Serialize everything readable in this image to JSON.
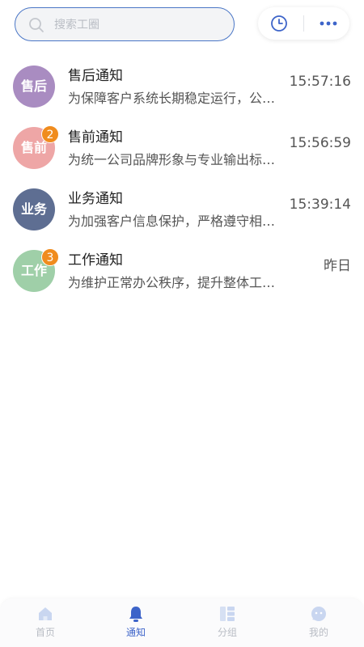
{
  "search": {
    "placeholder": "搜索工圈",
    "icon": "search-icon"
  },
  "header_actions": [
    {
      "icon": "clock-icon"
    },
    {
      "icon": "more-icon"
    }
  ],
  "notifications": [
    {
      "avatar_text": "售后",
      "avatar_color": "#a98cc1",
      "badge": "",
      "title": "售后通知",
      "preview": "为保障客户系统长期稳定运行，公司现推出…",
      "time": "15:57:16"
    },
    {
      "avatar_text": "售前",
      "avatar_color": "#eea6a6",
      "badge": "2",
      "title": "售前通知",
      "preview": "为统一公司品牌形象与专业输出标准，特此…",
      "time": "15:56:59"
    },
    {
      "avatar_text": "业务",
      "avatar_color": "#5e6e92",
      "badge": "",
      "title": "业务通知",
      "preview": "为加强客户信息保护，严格遵守相关法规…",
      "time": "15:39:14"
    },
    {
      "avatar_text": "工作",
      "avatar_color": "#9fcfa8",
      "badge": "3",
      "title": "工作通知",
      "preview": "为维护正常办公秩序，提升整体工作效率…",
      "time": "昨日"
    }
  ],
  "tabbar": {
    "active_color": "#3d64c9",
    "inactive_color": "#b8bcc4",
    "items": [
      {
        "label": "首页",
        "icon": "home-icon"
      },
      {
        "label": "通知",
        "icon": "bell-icon",
        "active": true
      },
      {
        "label": "分组",
        "icon": "group-icon"
      },
      {
        "label": "我的",
        "icon": "profile-icon"
      }
    ]
  }
}
